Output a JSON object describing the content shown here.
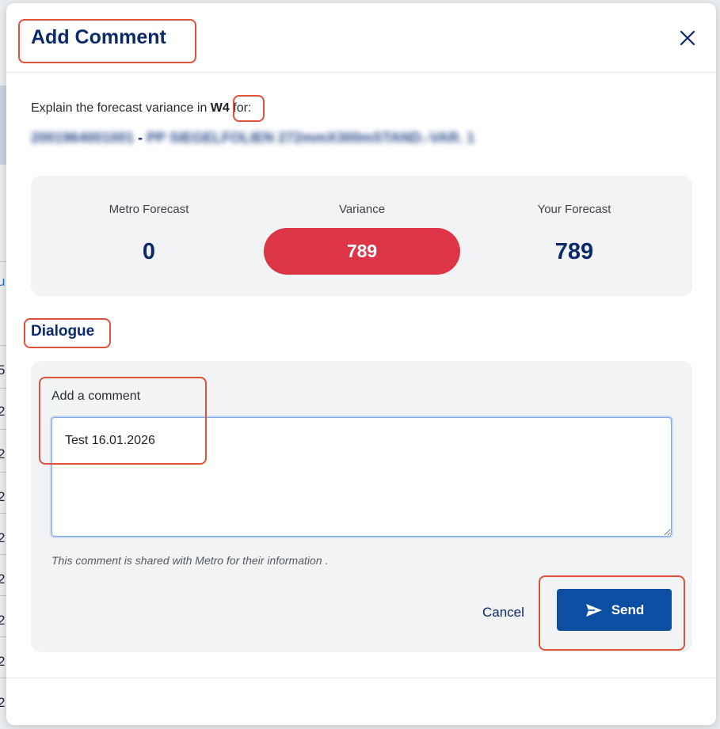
{
  "modal": {
    "title": "Add Comment",
    "close_icon": "close-icon"
  },
  "context": {
    "explain_prefix": "Explain the forecast variance in",
    "week": "W4",
    "explain_suffix": "for:",
    "item_code": "2001964001001",
    "item_separator": "-",
    "item_description": "PP SIEGELFOLIEN 272mmX300mSTAND.-VAR. 1"
  },
  "summary": {
    "metro_forecast_label": "Metro Forecast",
    "metro_forecast_value": "0",
    "variance_label": "Variance",
    "variance_value": "789",
    "your_forecast_label": "Your Forecast",
    "your_forecast_value": "789"
  },
  "dialogue": {
    "section_title": "Dialogue",
    "comment_label": "Add a comment",
    "comment_value": "Test 16.01.2026",
    "hint": "This comment is shared with Metro for their information .",
    "cancel_label": "Cancel",
    "send_label": "Send",
    "send_icon": "send-icon"
  },
  "background": {
    "edge_glyphs": [
      "u",
      "5",
      "2",
      "2",
      "2",
      "2",
      "2",
      "2",
      "2",
      "2"
    ]
  },
  "colors": {
    "primary": "#0c2a6b",
    "button": "#0b4ea2",
    "variance": "#dc3545",
    "annotation": "#e0513a"
  }
}
